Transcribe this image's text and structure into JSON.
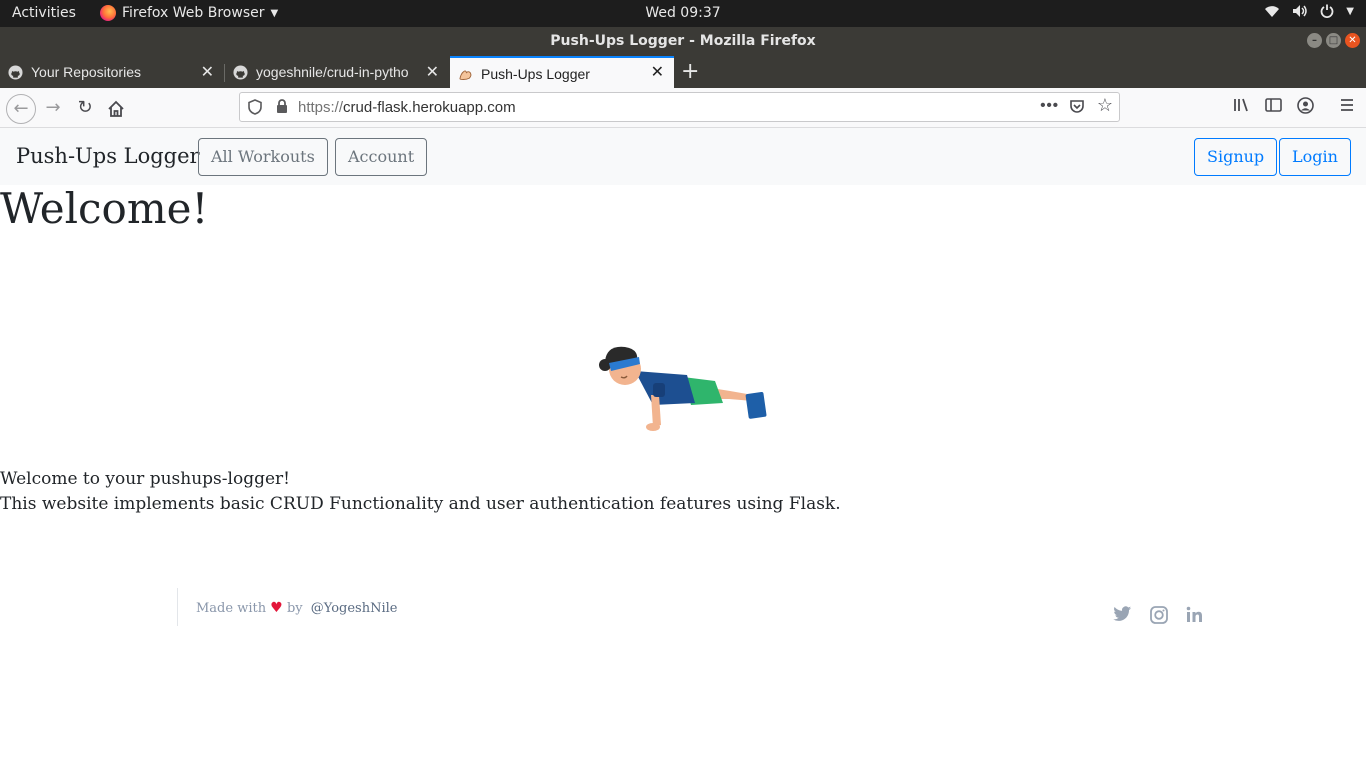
{
  "system_bar": {
    "activities": "Activities",
    "app_menu": "Firefox Web Browser",
    "clock": "Wed 09:37"
  },
  "window": {
    "title": "Push-Ups Logger - Mozilla Firefox"
  },
  "tabs": [
    {
      "label": "Your Repositories",
      "icon": "github-icon"
    },
    {
      "label": "yogeshnile/crud-in-pytho",
      "icon": "github-icon"
    },
    {
      "label": "Push-Ups Logger",
      "icon": "flexed-arm-icon",
      "active": true
    }
  ],
  "url_bar": {
    "protocol": "https://",
    "host": "crud-flask.herokuapp.com"
  },
  "site": {
    "brand": "Push-Ups Logger",
    "nav": {
      "all_workouts": "All Workouts",
      "account": "Account",
      "signup": "Signup",
      "login": "Login"
    },
    "heading": "Welcome!",
    "intro_line1": "Welcome to your pushups-logger!",
    "intro_line2": "This website implements basic CRUD Functionality and user authentication features using Flask.",
    "footer": {
      "made_with": "Made with",
      "heart": "♥",
      "by": "by",
      "handle": "@YogeshNile"
    },
    "social_icons": [
      "twitter-icon",
      "instagram-icon",
      "linkedin-icon"
    ]
  },
  "colors": {
    "primary": "#007bff",
    "secondary": "#6c757d",
    "navbar_bg": "#f8f9fa",
    "heart": "#e3173a"
  }
}
